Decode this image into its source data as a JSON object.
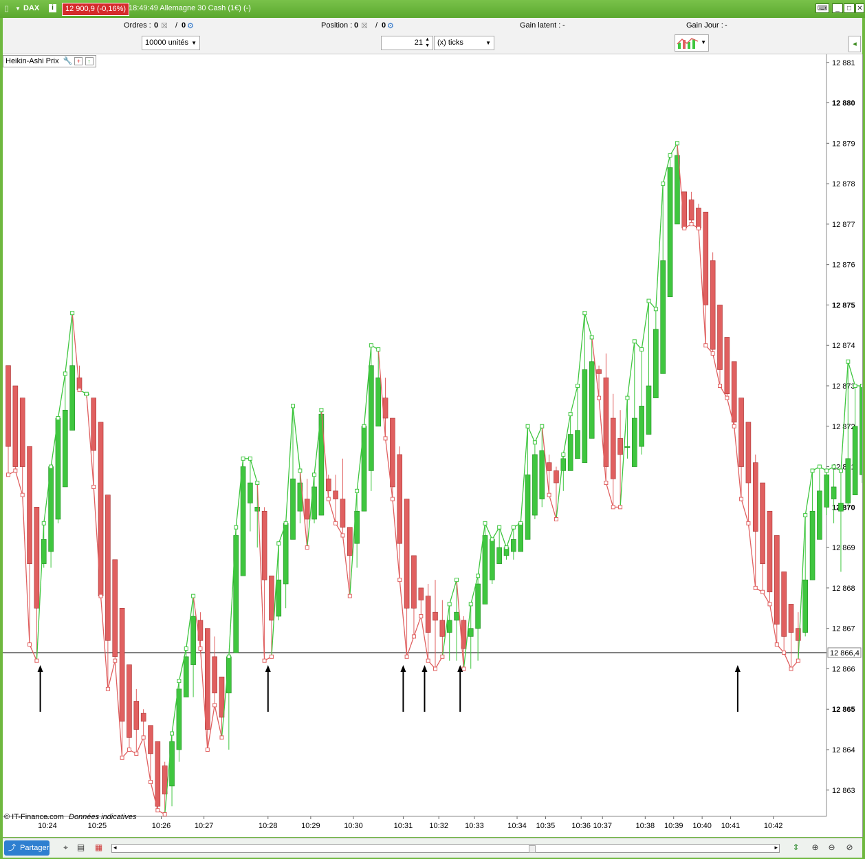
{
  "titlebar": {
    "symbol": "DAX",
    "info_icon": "i",
    "price_badge": "12 900,9 (-0,16%)",
    "title": "18:49:49 Allemagne 30 Cash (1€) (-)"
  },
  "toolbar": {
    "orders_label": "Ordres :",
    "orders_value": "0",
    "orders_value2": "0",
    "position_label": "Position :",
    "position_value": "0",
    "position_value2": "0",
    "gain_latent_label": "Gain latent :",
    "gain_latent_value": "-",
    "gain_jour_label": "Gain Jour :",
    "gain_jour_value": "-",
    "units_select": "10000 unités",
    "ticks_value": "21",
    "ticks_select": "(x) ticks"
  },
  "chart_panel": {
    "legend": "Heikin-Ashi Prix",
    "credit_source": "© IT-Finance.com",
    "credit_note": "Données indicatives",
    "crosshair_label": "12 866,4"
  },
  "bottombar": {
    "share_label": "Partager"
  },
  "colors": {
    "up": "#3fc63f",
    "down": "#e06060",
    "frame": "#6fb83f"
  },
  "chart_data": {
    "type": "candlestick",
    "title": "",
    "ylim": [
      12862.35,
      12881.2
    ],
    "y_ticks": [
      {
        "v": 12863,
        "label": "12 863",
        "bold": false
      },
      {
        "v": 12864,
        "label": "12 864",
        "bold": false
      },
      {
        "v": 12865,
        "label": "12 865",
        "bold": true
      },
      {
        "v": 12866,
        "label": "12 866",
        "bold": false
      },
      {
        "v": 12867,
        "label": "12 867",
        "bold": false
      },
      {
        "v": 12868,
        "label": "12 868",
        "bold": false
      },
      {
        "v": 12869,
        "label": "12 869",
        "bold": false
      },
      {
        "v": 12870,
        "label": "12 870",
        "bold": true
      },
      {
        "v": 12871,
        "label": "12 871",
        "bold": false
      },
      {
        "v": 12872,
        "label": "12 872",
        "bold": false
      },
      {
        "v": 12873,
        "label": "12 873",
        "bold": false
      },
      {
        "v": 12874,
        "label": "12 874",
        "bold": false
      },
      {
        "v": 12875,
        "label": "12 875",
        "bold": true
      },
      {
        "v": 12876,
        "label": "12 876",
        "bold": false
      },
      {
        "v": 12877,
        "label": "12 877",
        "bold": false
      },
      {
        "v": 12878,
        "label": "12 878",
        "bold": false
      },
      {
        "v": 12879,
        "label": "12 879",
        "bold": false
      },
      {
        "v": 12880,
        "label": "12 880",
        "bold": true
      },
      {
        "v": 12881,
        "label": "12 881",
        "bold": false
      }
    ],
    "x_ticks": [
      {
        "bar": 5.5,
        "label": "10:24"
      },
      {
        "bar": 12.5,
        "label": "10:25"
      },
      {
        "bar": 21.5,
        "label": "10:26"
      },
      {
        "bar": 27.5,
        "label": "10:27"
      },
      {
        "bar": 36.5,
        "label": "10:28"
      },
      {
        "bar": 42.5,
        "label": "10:29"
      },
      {
        "bar": 48.5,
        "label": "10:30"
      },
      {
        "bar": 55.5,
        "label": "10:31"
      },
      {
        "bar": 60.5,
        "label": "10:32"
      },
      {
        "bar": 65.5,
        "label": "10:33"
      },
      {
        "bar": 71.5,
        "label": "10:34"
      },
      {
        "bar": 75.5,
        "label": "10:35"
      },
      {
        "bar": 80.5,
        "label": "10:36"
      },
      {
        "bar": 83.5,
        "label": "10:37"
      },
      {
        "bar": 89.5,
        "label": "10:38"
      },
      {
        "bar": 93.5,
        "label": "10:39"
      },
      {
        "bar": 97.5,
        "label": "10:40"
      },
      {
        "bar": 101.5,
        "label": "10:41"
      },
      {
        "bar": 107.5,
        "label": "10:42"
      }
    ],
    "crosshair_price": 12866.4,
    "arrow_bars": [
      4.5,
      36.5,
      55.5,
      58.5,
      63.5,
      102.5
    ],
    "candles": [
      [
        12873.5,
        12871.5,
        12873.5,
        12870.8
      ],
      [
        12873.0,
        12871.0,
        12873.0,
        12870.9
      ],
      [
        12872.7,
        12871.0,
        12872.7,
        12870.3
      ],
      [
        12871.5,
        12868.6,
        12871.5,
        12866.6
      ],
      [
        12870.0,
        12867.5,
        12870.0,
        12866.2
      ],
      [
        12868.6,
        12869.2,
        12869.6,
        12868.5
      ],
      [
        12868.9,
        12871.0,
        12871.0,
        12868.5
      ],
      [
        12869.7,
        12872.2,
        12872.2,
        12869.6
      ],
      [
        12870.5,
        12872.4,
        12873.3,
        12870.5
      ],
      [
        12871.9,
        12873.5,
        12874.8,
        12871.9
      ],
      [
        12873.2,
        12872.9,
        12873.5,
        12872.9
      ],
      [
        12872.8,
        12872.8,
        12872.8,
        12872.7
      ],
      [
        12872.7,
        12871.4,
        12872.7,
        12870.5
      ],
      [
        12872.1,
        12867.8,
        12872.1,
        12867.8
      ],
      [
        12870.3,
        12866.7,
        12870.3,
        12865.5
      ],
      [
        12868.7,
        12866.3,
        12868.7,
        12866.2
      ],
      [
        12867.5,
        12864.7,
        12867.5,
        12863.8
      ],
      [
        12866.1,
        12864.3,
        12866.1,
        12864.0
      ],
      [
        12865.2,
        12864.5,
        12865.5,
        12863.9
      ],
      [
        12864.9,
        12864.7,
        12865.0,
        12864.3
      ],
      [
        12864.6,
        12863.9,
        12864.6,
        12863.2
      ],
      [
        12864.2,
        12862.6,
        12864.2,
        12862.5
      ],
      [
        12863.6,
        12862.9,
        12863.7,
        12862.4
      ],
      [
        12863.1,
        12864.2,
        12864.4,
        12862.6
      ],
      [
        12864.0,
        12865.5,
        12865.7,
        12863.7
      ],
      [
        12865.3,
        12866.3,
        12866.5,
        12865.3
      ],
      [
        12866.1,
        12867.3,
        12867.8,
        12865.3
      ],
      [
        12867.2,
        12866.7,
        12867.4,
        12866.5
      ],
      [
        12867.0,
        12864.5,
        12867.0,
        12864.0
      ],
      [
        12866.3,
        12865.4,
        12866.8,
        12865.1
      ],
      [
        12865.8,
        12864.8,
        12865.8,
        12864.3
      ],
      [
        12865.4,
        12866.3,
        12866.3,
        12864.0
      ],
      [
        12866.4,
        12869.3,
        12869.5,
        12866.4
      ],
      [
        12868.3,
        12871.0,
        12871.2,
        12868.3
      ],
      [
        12870.1,
        12870.6,
        12871.2,
        12869.4
      ],
      [
        12869.9,
        12870.0,
        12870.6,
        12869.0
      ],
      [
        12869.9,
        12868.2,
        12870.0,
        12866.2
      ],
      [
        12868.3,
        12867.2,
        12868.3,
        12866.3
      ],
      [
        12867.3,
        12868.2,
        12869.1,
        12867.2
      ],
      [
        12868.1,
        12869.6,
        12869.6,
        12867.5
      ],
      [
        12869.2,
        12870.7,
        12872.5,
        12869.2
      ],
      [
        12869.9,
        12870.6,
        12870.9,
        12869.6
      ],
      [
        12870.2,
        12869.7,
        12870.7,
        12869.0
      ],
      [
        12869.7,
        12870.5,
        12870.8,
        12869.6
      ],
      [
        12869.8,
        12872.3,
        12872.4,
        12869.8
      ],
      [
        12870.7,
        12870.4,
        12870.8,
        12870.2
      ],
      [
        12870.4,
        12870.2,
        12870.8,
        12869.6
      ],
      [
        12870.2,
        12869.5,
        12871.2,
        12869.3
      ],
      [
        12869.5,
        12868.8,
        12869.5,
        12867.8
      ],
      [
        12869.1,
        12869.9,
        12870.4,
        12868.5
      ],
      [
        12869.9,
        12872.0,
        12872.0,
        12869.9
      ],
      [
        12870.9,
        12873.5,
        12874.0,
        12870.4
      ],
      [
        12872.0,
        12873.2,
        12873.9,
        12872.0
      ],
      [
        12872.7,
        12872.2,
        12873.2,
        12871.7
      ],
      [
        12872.2,
        12870.5,
        12872.2,
        12870.2
      ],
      [
        12871.3,
        12869.1,
        12871.5,
        12868.2
      ],
      [
        12870.2,
        12867.5,
        12870.2,
        12866.3
      ],
      [
        12868.8,
        12867.5,
        12868.8,
        12866.8
      ],
      [
        12868.0,
        12867.7,
        12868.0,
        12867.3
      ],
      [
        12867.8,
        12866.9,
        12868.1,
        12866.2
      ],
      [
        12867.4,
        12867.2,
        12868.2,
        12866.0
      ],
      [
        12867.2,
        12866.8,
        12867.7,
        12866.3
      ],
      [
        12866.9,
        12867.2,
        12867.6,
        12866.2
      ],
      [
        12867.2,
        12867.4,
        12868.2,
        12866.2
      ],
      [
        12867.2,
        12866.5,
        12867.3,
        12866.0
      ],
      [
        12866.8,
        12867.0,
        12867.6,
        12866.0
      ],
      [
        12867.0,
        12868.1,
        12868.3,
        12866.2
      ],
      [
        12867.6,
        12869.3,
        12869.6,
        12867.6
      ],
      [
        12868.2,
        12869.2,
        12869.2,
        12868.1
      ],
      [
        12868.6,
        12869.0,
        12869.5,
        12868.6
      ],
      [
        12868.8,
        12869.0,
        12869.0,
        12868.7
      ],
      [
        12868.9,
        12869.2,
        12869.5,
        12868.7
      ],
      [
        12868.9,
        12869.6,
        12869.6,
        12868.9
      ],
      [
        12869.2,
        12870.8,
        12872.0,
        12869.2
      ],
      [
        12869.8,
        12871.3,
        12871.6,
        12869.7
      ],
      [
        12870.2,
        12871.4,
        12872.0,
        12870.0
      ],
      [
        12871.1,
        12870.9,
        12871.3,
        12870.3
      ],
      [
        12870.9,
        12870.6,
        12871.0,
        12869.7
      ],
      [
        12870.9,
        12871.2,
        12871.3,
        12870.4
      ],
      [
        12870.9,
        12871.8,
        12872.3,
        12870.9
      ],
      [
        12871.2,
        12871.9,
        12873.0,
        12871.2
      ],
      [
        12871.1,
        12873.4,
        12874.8,
        12871.1
      ],
      [
        12871.7,
        12873.6,
        12874.2,
        12871.7
      ],
      [
        12873.4,
        12873.3,
        12873.5,
        12872.7
      ],
      [
        12873.2,
        12871.0,
        12873.8,
        12870.6
      ],
      [
        12872.2,
        12870.7,
        12872.8,
        12870.0
      ],
      [
        12871.7,
        12871.3,
        12872.4,
        12870.0
      ],
      [
        12871.5,
        12871.5,
        12872.7,
        12871.2
      ],
      [
        12871.0,
        12872.2,
        12874.1,
        12871.0
      ],
      [
        12871.5,
        12872.5,
        12873.9,
        12871.3
      ],
      [
        12871.8,
        12873.0,
        12875.1,
        12871.8
      ],
      [
        12872.7,
        12874.4,
        12874.9,
        12872.7
      ],
      [
        12873.3,
        12876.1,
        12878.0,
        12873.3
      ],
      [
        12875.2,
        12878.4,
        12878.7,
        12875.2
      ],
      [
        12877.0,
        12878.7,
        12879.0,
        12877.0
      ],
      [
        12877.8,
        12876.9,
        12877.8,
        12876.9
      ],
      [
        12877.6,
        12877.1,
        12877.8,
        12877.0
      ],
      [
        12877.4,
        12876.9,
        12877.5,
        12876.9
      ],
      [
        12877.3,
        12875.0,
        12877.3,
        12874.0
      ],
      [
        12876.1,
        12873.9,
        12876.3,
        12873.8
      ],
      [
        12875.0,
        12873.4,
        12875.0,
        12873.0
      ],
      [
        12874.2,
        12872.8,
        12874.2,
        12872.7
      ],
      [
        12873.6,
        12872.1,
        12873.6,
        12872.0
      ],
      [
        12872.7,
        12871.0,
        12872.7,
        12870.2
      ],
      [
        12872.1,
        12870.6,
        12872.1,
        12869.6
      ],
      [
        12871.1,
        12869.4,
        12871.3,
        12868.0
      ],
      [
        12870.6,
        12868.6,
        12870.6,
        12867.9
      ],
      [
        12869.9,
        12867.9,
        12869.9,
        12867.6
      ],
      [
        12869.3,
        12867.1,
        12869.3,
        12866.6
      ],
      [
        12868.4,
        12866.8,
        12868.4,
        12866.4
      ],
      [
        12867.6,
        12866.9,
        12867.6,
        12866.0
      ],
      [
        12867.0,
        12866.7,
        12867.4,
        12866.2
      ],
      [
        12866.9,
        12868.2,
        12869.8,
        12866.8
      ],
      [
        12868.2,
        12869.9,
        12870.9,
        12868.2
      ],
      [
        12869.2,
        12870.4,
        12871.0,
        12869.2
      ],
      [
        12870.0,
        12870.8,
        12870.9,
        12869.8
      ],
      [
        12870.2,
        12870.5,
        12871.0,
        12869.6
      ],
      [
        12869.9,
        12870.1,
        12870.9,
        12868.4
      ],
      [
        12870.1,
        12871.2,
        12873.6,
        12870.0
      ],
      [
        12870.3,
        12872.0,
        12873.0,
        12870.3
      ],
      [
        12870.8,
        12873.0,
        12873.0,
        12870.6
      ]
    ]
  }
}
